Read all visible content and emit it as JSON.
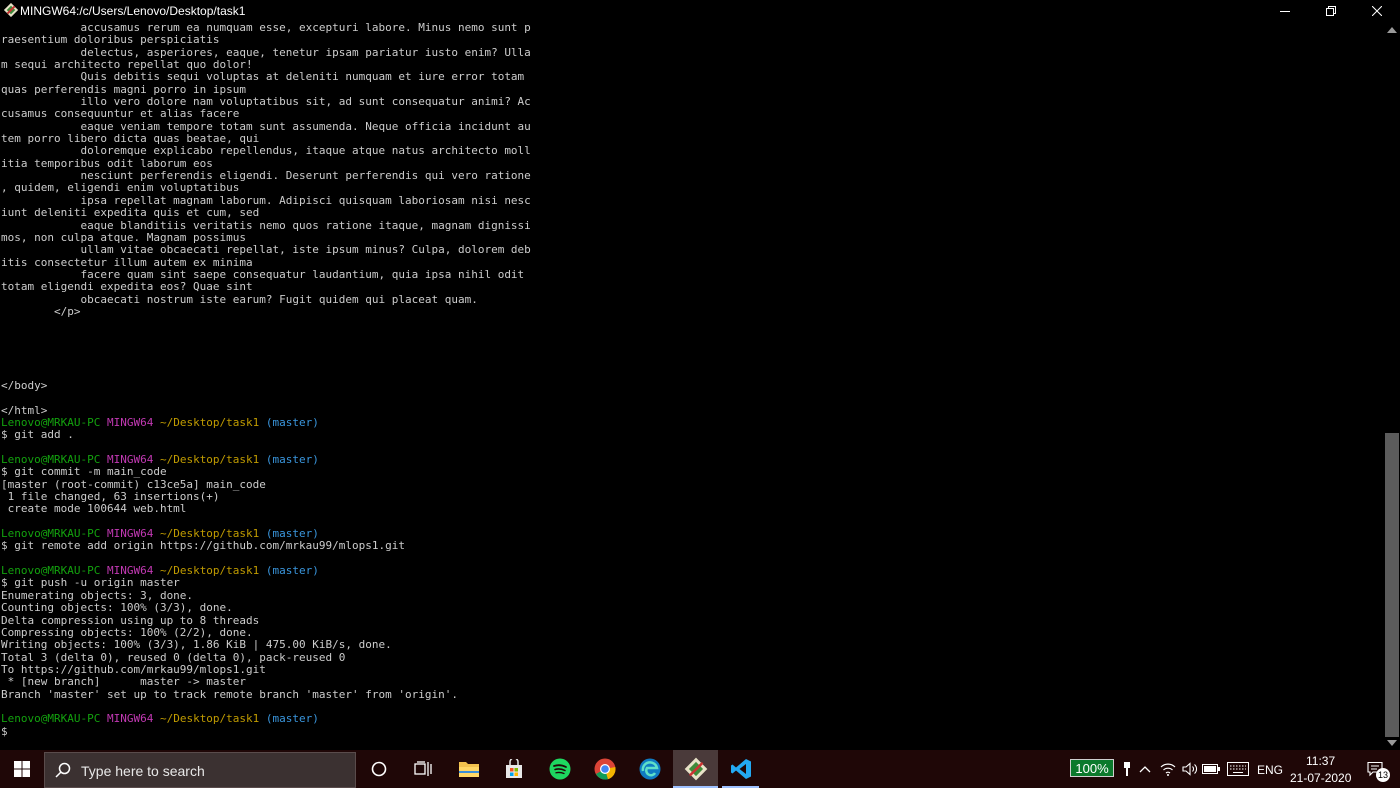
{
  "window": {
    "title": "MINGW64:/c/Users/Lenovo/Desktop/task1"
  },
  "terminal": {
    "lines": [
      [
        {
          "t": "            accusamus rerum ea numquam esse, excepturi labore. Minus nemo sunt p"
        }
      ],
      [
        {
          "t": "raesentium doloribus perspiciatis"
        }
      ],
      [
        {
          "t": "            delectus, asperiores, eaque, tenetur ipsam pariatur iusto enim? Ulla"
        }
      ],
      [
        {
          "t": "m sequi architecto repellat quo dolor!"
        }
      ],
      [
        {
          "t": "            Quis debitis sequi voluptas at deleniti numquam et iure error totam "
        }
      ],
      [
        {
          "t": "quas perferendis magni porro in ipsum"
        }
      ],
      [
        {
          "t": "            illo vero dolore nam voluptatibus sit, ad sunt consequatur animi? Ac"
        }
      ],
      [
        {
          "t": "cusamus consequuntur et alias facere"
        }
      ],
      [
        {
          "t": "            eaque veniam tempore totam sunt assumenda. Neque officia incidunt au"
        }
      ],
      [
        {
          "t": "tem porro libero dicta quas beatae, qui"
        }
      ],
      [
        {
          "t": "            doloremque explicabo repellendus, itaque atque natus architecto moll"
        }
      ],
      [
        {
          "t": "itia temporibus odit laborum eos"
        }
      ],
      [
        {
          "t": "            nesciunt perferendis eligendi. Deserunt perferendis qui vero ratione"
        }
      ],
      [
        {
          "t": ", quidem, eligendi enim voluptatibus"
        }
      ],
      [
        {
          "t": "            ipsa repellat magnam laborum. Adipisci quisquam laboriosam nisi nesc"
        }
      ],
      [
        {
          "t": "iunt deleniti expedita quis et cum, sed"
        }
      ],
      [
        {
          "t": "            eaque blanditiis veritatis nemo quos ratione itaque, magnam dignissi"
        }
      ],
      [
        {
          "t": "mos, non culpa atque. Magnam possimus"
        }
      ],
      [
        {
          "t": "            ullam vitae obcaecati repellat, iste ipsum minus? Culpa, dolorem deb"
        }
      ],
      [
        {
          "t": "itis consectetur illum autem ex minima"
        }
      ],
      [
        {
          "t": "            facere quam sint saepe consequatur laudantium, quia ipsa nihil odit "
        }
      ],
      [
        {
          "t": "totam eligendi expedita eos? Quae sint"
        }
      ],
      [
        {
          "t": "            obcaecati nostrum iste earum? Fugit quidem qui placeat quam."
        }
      ],
      [
        {
          "t": "        </p>"
        }
      ],
      [
        {
          "t": ""
        }
      ],
      [
        {
          "t": ""
        }
      ],
      [
        {
          "t": ""
        }
      ],
      [
        {
          "t": ""
        }
      ],
      [
        {
          "t": ""
        }
      ],
      [
        {
          "t": "</body>"
        }
      ],
      [
        {
          "t": ""
        }
      ],
      [
        {
          "t": "</html>"
        }
      ],
      [
        {
          "t": "Lenovo@MRKAU-PC",
          "c": "g"
        },
        {
          "t": " "
        },
        {
          "t": "MINGW64",
          "c": "m"
        },
        {
          "t": " "
        },
        {
          "t": "~/Desktop/task1",
          "c": "y"
        },
        {
          "t": " "
        },
        {
          "t": "(master)",
          "c": "c"
        }
      ],
      [
        {
          "t": "$ git add ."
        }
      ],
      [
        {
          "t": ""
        }
      ],
      [
        {
          "t": "Lenovo@MRKAU-PC",
          "c": "g"
        },
        {
          "t": " "
        },
        {
          "t": "MINGW64",
          "c": "m"
        },
        {
          "t": " "
        },
        {
          "t": "~/Desktop/task1",
          "c": "y"
        },
        {
          "t": " "
        },
        {
          "t": "(master)",
          "c": "c"
        }
      ],
      [
        {
          "t": "$ git commit -m main_code"
        }
      ],
      [
        {
          "t": "[master (root-commit) c13ce5a] main_code"
        }
      ],
      [
        {
          "t": " 1 file changed, 63 insertions(+)"
        }
      ],
      [
        {
          "t": " create mode 100644 web.html"
        }
      ],
      [
        {
          "t": ""
        }
      ],
      [
        {
          "t": "Lenovo@MRKAU-PC",
          "c": "g"
        },
        {
          "t": " "
        },
        {
          "t": "MINGW64",
          "c": "m"
        },
        {
          "t": " "
        },
        {
          "t": "~/Desktop/task1",
          "c": "y"
        },
        {
          "t": " "
        },
        {
          "t": "(master)",
          "c": "c"
        }
      ],
      [
        {
          "t": "$ git remote add origin https://github.com/mrkau99/mlops1.git"
        }
      ],
      [
        {
          "t": ""
        }
      ],
      [
        {
          "t": "Lenovo@MRKAU-PC",
          "c": "g"
        },
        {
          "t": " "
        },
        {
          "t": "MINGW64",
          "c": "m"
        },
        {
          "t": " "
        },
        {
          "t": "~/Desktop/task1",
          "c": "y"
        },
        {
          "t": " "
        },
        {
          "t": "(master)",
          "c": "c"
        }
      ],
      [
        {
          "t": "$ git push -u origin master"
        }
      ],
      [
        {
          "t": "Enumerating objects: 3, done."
        }
      ],
      [
        {
          "t": "Counting objects: 100% (3/3), done."
        }
      ],
      [
        {
          "t": "Delta compression using up to 8 threads"
        }
      ],
      [
        {
          "t": "Compressing objects: 100% (2/2), done."
        }
      ],
      [
        {
          "t": "Writing objects: 100% (3/3), 1.86 KiB | 475.00 KiB/s, done."
        }
      ],
      [
        {
          "t": "Total 3 (delta 0), reused 0 (delta 0), pack-reused 0"
        }
      ],
      [
        {
          "t": "To https://github.com/mrkau99/mlops1.git"
        }
      ],
      [
        {
          "t": " * [new branch]      master -> master"
        }
      ],
      [
        {
          "t": "Branch 'master' set up to track remote branch 'master' from 'origin'."
        }
      ],
      [
        {
          "t": ""
        }
      ],
      [
        {
          "t": "Lenovo@MRKAU-PC",
          "c": "g"
        },
        {
          "t": " "
        },
        {
          "t": "MINGW64",
          "c": "m"
        },
        {
          "t": " "
        },
        {
          "t": "~/Desktop/task1",
          "c": "y"
        },
        {
          "t": " "
        },
        {
          "t": "(master)",
          "c": "c"
        }
      ],
      [
        {
          "t": "$"
        }
      ]
    ]
  },
  "taskbar": {
    "search_placeholder": "Type here to search",
    "apps": [
      "start-icon",
      "cortana-icon",
      "task-view-icon",
      "file-explorer-icon",
      "microsoft-store-icon",
      "spotify-icon",
      "chrome-icon",
      "edge-icon",
      "git-bash-icon",
      "vscode-icon"
    ],
    "battery_percent": "100%",
    "language": "ENG",
    "time": "11:37",
    "date": "21-07-2020",
    "notification_count": "13"
  },
  "colors": {
    "prompt_user": "#13a10e",
    "prompt_system": "#c239b3",
    "prompt_path": "#c19c00",
    "prompt_branch": "#3a96dd",
    "terminal_text": "#cccccc",
    "taskbar_bg": "#1f0707"
  }
}
